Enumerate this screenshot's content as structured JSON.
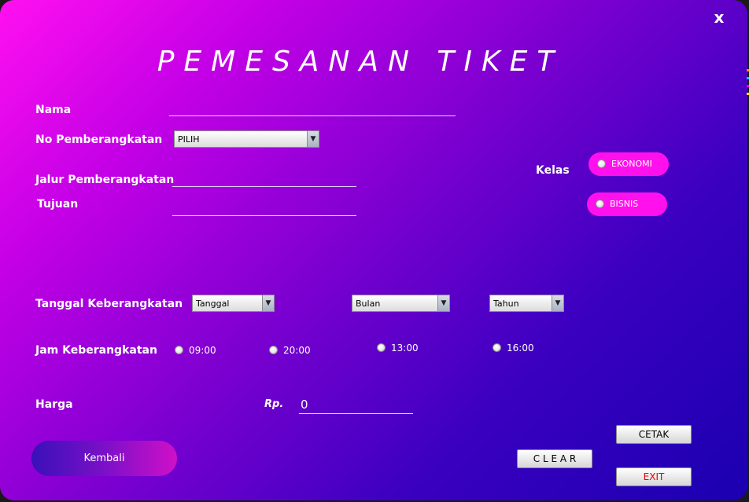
{
  "window": {
    "title": "PEMESANAN TIKET",
    "close_label": "x"
  },
  "form": {
    "nama": {
      "label": "Nama",
      "value": ""
    },
    "no_pemberangkatan": {
      "label": "No Pemberangkatan",
      "selected": "PILIH"
    },
    "jalur": {
      "label": "Jalur Pemberangkatan",
      "value": ""
    },
    "tujuan": {
      "label": "Tujuan",
      "value": ""
    },
    "kelas": {
      "label": "Kelas",
      "options": [
        {
          "label": "EKONOMI",
          "selected": false
        },
        {
          "label": "BISNIS",
          "selected": false
        }
      ]
    },
    "tanggal": {
      "label": "Tanggal Keberangkatan",
      "day": "Tanggal",
      "month": "Bulan",
      "year": "Tahun"
    },
    "jam": {
      "label": "Jam Keberangkatan",
      "options": [
        {
          "label": "09:00",
          "selected": false
        },
        {
          "label": "20:00",
          "selected": false
        },
        {
          "label": "13:00",
          "selected": false
        },
        {
          "label": "16:00",
          "selected": false
        }
      ]
    },
    "harga": {
      "label": "Harga",
      "currency": "Rp.",
      "value": "0"
    }
  },
  "buttons": {
    "kembali": "Kembali",
    "clear": "C L E A R",
    "cetak": "CETAK",
    "exit": "EXIT"
  },
  "colors": {
    "gradient_start": "#ff10f0",
    "gradient_end": "#1a00b0",
    "pill": "#ff10ec",
    "exit_text": "#e00000"
  }
}
